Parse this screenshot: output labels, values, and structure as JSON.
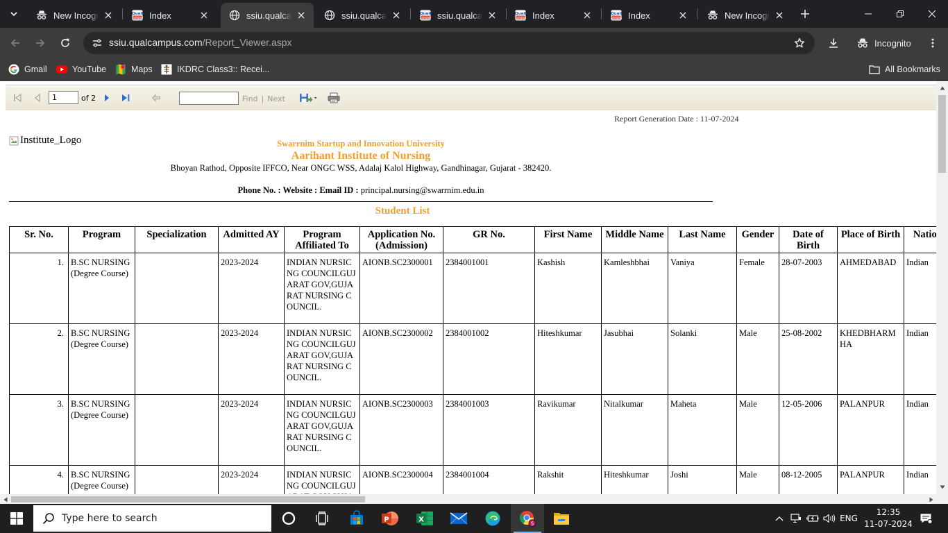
{
  "browser": {
    "tabs": [
      {
        "title": "New Incognito Tab",
        "favicon": "incognito",
        "active": false
      },
      {
        "title": "Index",
        "favicon": "qualcampus",
        "active": false
      },
      {
        "title": "ssiu.qualcampus.com",
        "favicon": "globe",
        "active": true
      },
      {
        "title": "ssiu.qualcampus.com",
        "favicon": "globe",
        "active": false
      },
      {
        "title": "ssiu.qualcampus.com",
        "favicon": "qualcampus",
        "active": false
      },
      {
        "title": "Index",
        "favicon": "qualcampus",
        "active": false
      },
      {
        "title": "Index",
        "favicon": "qualcampus",
        "active": false
      },
      {
        "title": "New Incognito Tab",
        "favicon": "incognito",
        "active": false
      }
    ],
    "url_host": "ssiu.qualcampus.com",
    "url_path": "/Report_Viewer.aspx",
    "incognito_label": "Incognito",
    "bookmarks": [
      {
        "label": "Gmail",
        "icon": "google-g"
      },
      {
        "label": "YouTube",
        "icon": "youtube"
      },
      {
        "label": "Maps",
        "icon": "maps"
      },
      {
        "label": "IKDRC Class3:: Recei...",
        "icon": "emblem"
      }
    ],
    "all_bookmarks_label": "All Bookmarks"
  },
  "report_viewer": {
    "page_value": "1",
    "page_total_label": "of 2",
    "find_label": "Find",
    "find_sep": "|",
    "next_label": "Next"
  },
  "report": {
    "generation_date": "Report Generation Date : 11-07-2024",
    "logo_alt": "Institute_Logo",
    "university": "Swarrnim Startup and Innovation University",
    "institute": "Aarihant Institute of Nursing",
    "address": "Bhoyan Rathod, Opposite IFFCO, Near ONGC WSS, Adalaj Kalol Highway, Gandhinagar, Gujarat - 382420.",
    "phone_label": "Phone No. : ",
    "website_label": "Website : ",
    "email_label": "Email ID : ",
    "email": "principal.nursing@swarrnim.edu.in",
    "list_title": "Student List",
    "table": {
      "headers": [
        "Sr. No.",
        "Program",
        "Specialization",
        "Admitted AY",
        "Program Affiliated To",
        "Application No. (Admission)",
        "GR No.",
        "First Name",
        "Middle Name",
        "Last Name",
        "Gender",
        "Date of Birth",
        "Place of Birth",
        "Nationality"
      ],
      "rows": [
        [
          "1.",
          "B.SC NURSING (Degree Course)",
          "",
          "2023-2024",
          "INDIAN NURSICNG COUNCILGUJARAT GOV,GUJARAT NURSING COUNCIL.",
          "AIONB.SC2300001",
          "2384001001",
          "Kashish",
          "Kamleshbhai",
          "Vaniya",
          "Female",
          "28-07-2003",
          "AHMEDABAD",
          "Indian"
        ],
        [
          "2.",
          "B.SC NURSING (Degree Course)",
          "",
          "2023-2024",
          "INDIAN NURSICNG COUNCILGUJARAT GOV,GUJARAT NURSING COUNCIL.",
          "AIONB.SC2300002",
          "2384001002",
          "Hiteshkumar",
          "Jasubhai",
          "Solanki",
          "Male",
          "25-08-2002",
          "KHEDBHARMHA",
          "Indian"
        ],
        [
          "3.",
          "B.SC NURSING (Degree Course)",
          "",
          "2023-2024",
          "INDIAN NURSICNG COUNCILGUJARAT GOV,GUJARAT NURSING COUNCIL.",
          "AIONB.SC2300003",
          "2384001003",
          "Ravikumar",
          "Nitalkumar",
          "Maheta",
          "Male",
          "12-05-2006",
          "PALANPUR",
          "Indian"
        ],
        [
          "4.",
          "B.SC NURSING (Degree Course)",
          "",
          "2023-2024",
          "INDIAN NURSICNG COUNCILGUJARAT GOV,GUJARAT NURSING COUNCIL.",
          "AIONB.SC2300004",
          "2384001004",
          "Rakshit",
          "Hiteshkumar",
          "Joshi",
          "Male",
          "08-12-2005",
          "PALANPUR",
          "Indian"
        ]
      ]
    }
  },
  "taskbar": {
    "search_placeholder": "Type here to search",
    "apps": [
      {
        "icon": "cortana",
        "active": false
      },
      {
        "icon": "task-view",
        "active": false
      },
      {
        "icon": "microsoft-store",
        "active": false
      },
      {
        "icon": "powerpoint",
        "active": false
      },
      {
        "icon": "excel",
        "active": false
      },
      {
        "icon": "mail",
        "active": false
      },
      {
        "icon": "edge",
        "active": false
      },
      {
        "icon": "chrome",
        "active": true
      },
      {
        "icon": "file-explorer",
        "active": false
      }
    ],
    "language": "ENG",
    "time": "12:35",
    "date": "11-07-2024"
  },
  "colors": {
    "chrome_dark": "#202124",
    "report_orange": "#f0a030",
    "toolbar_blue": "#1e5fbf"
  }
}
